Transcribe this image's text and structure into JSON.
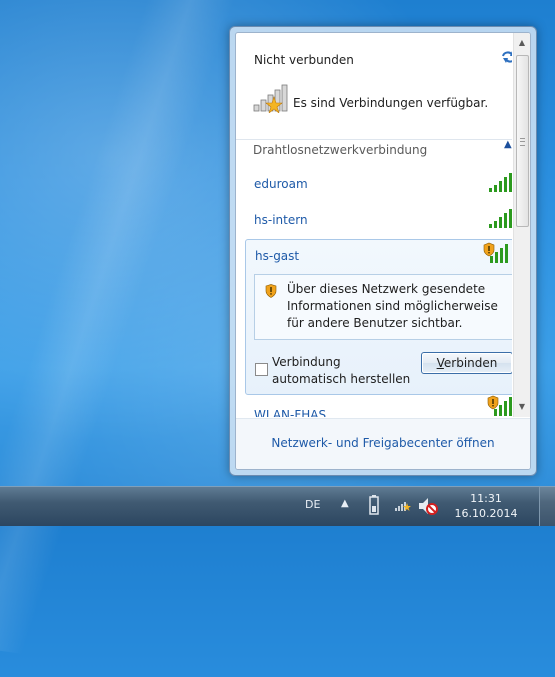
{
  "flyout": {
    "status_title": "Nicht verbunden",
    "availability_text": "Es sind Verbindungen verfügbar.",
    "section_label": "Drahtlosnetzwerkverbindung",
    "networks": [
      {
        "name": "eduroam",
        "secured": true
      },
      {
        "name": "hs-intern",
        "secured": true
      },
      {
        "name": "hs-gast",
        "secured": false
      },
      {
        "name": "WLAN-FHAS",
        "secured": false
      }
    ],
    "expanded_network": {
      "warning_text": "Über dieses Netzwerk gesendete Informationen sind möglicherweise für andere Benutzer sichtbar.",
      "auto_connect_label": "Verbindung automatisch herstellen",
      "connect_button_prefix": "V",
      "connect_button_rest": "erbinden",
      "auto_connect_checked": false
    },
    "footer_link": "Netzwerk- und Freigabecenter öffnen"
  },
  "taskbar": {
    "language": "DE",
    "time": "11:31",
    "date": "16.10.2014"
  },
  "colors": {
    "link_blue": "#1e5aa8",
    "signal_green": "#2c9a1e",
    "shield_orange": "#f0a21c"
  },
  "icons": {
    "refresh": "refresh-arrows-icon",
    "availability": "wifi-available-star-icon",
    "signal": "signal-bars-icon",
    "warning_shield": "warning-shield-icon",
    "battery": "battery-icon",
    "network_tray": "network-tray-icon",
    "volume_muted": "volume-muted-icon"
  }
}
